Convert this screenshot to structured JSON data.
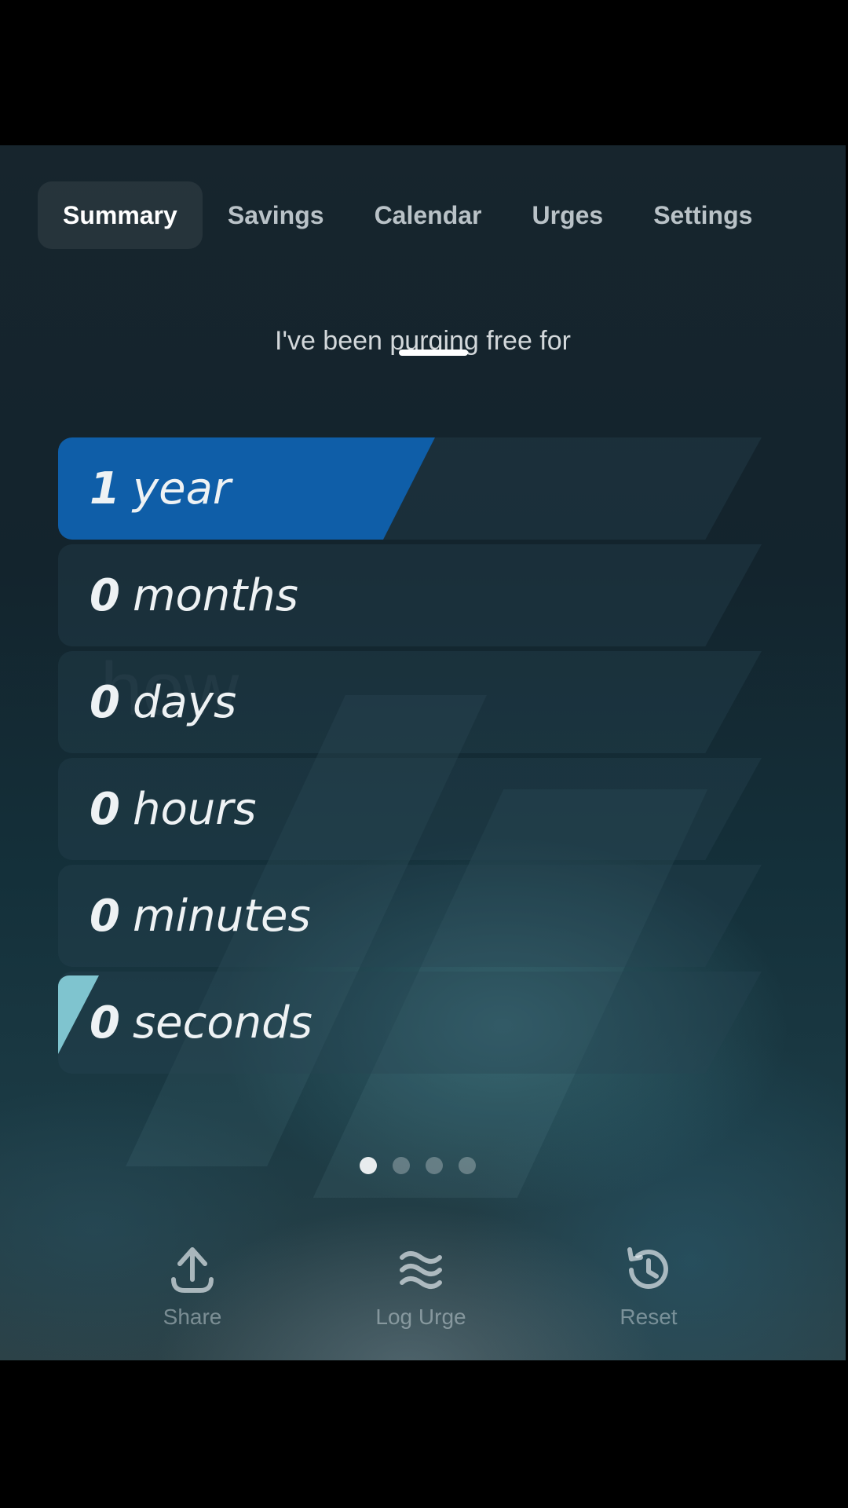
{
  "tabs": [
    "Summary",
    "Savings",
    "Calendar",
    "Urges",
    "Settings"
  ],
  "intro_text": "I've been purging free for",
  "counter": [
    {
      "num": "1",
      "unit": "year"
    },
    {
      "num": "0",
      "unit": "months"
    },
    {
      "num": "0",
      "unit": "days"
    },
    {
      "num": "0",
      "unit": "hours"
    },
    {
      "num": "0",
      "unit": "minutes"
    },
    {
      "num": "0",
      "unit": "seconds"
    }
  ],
  "ghost_text": "how",
  "page_indicator": {
    "count": 4,
    "active": 1
  },
  "actions": [
    {
      "label": "Share",
      "icon": "share-upload-icon"
    },
    {
      "label": "Log Urge",
      "icon": "waves-icon"
    },
    {
      "label": "Reset",
      "icon": "history-reset-icon"
    }
  ],
  "colors": {
    "accent": "#0f5ea8",
    "seconds_accent": "#7fc4cf"
  }
}
